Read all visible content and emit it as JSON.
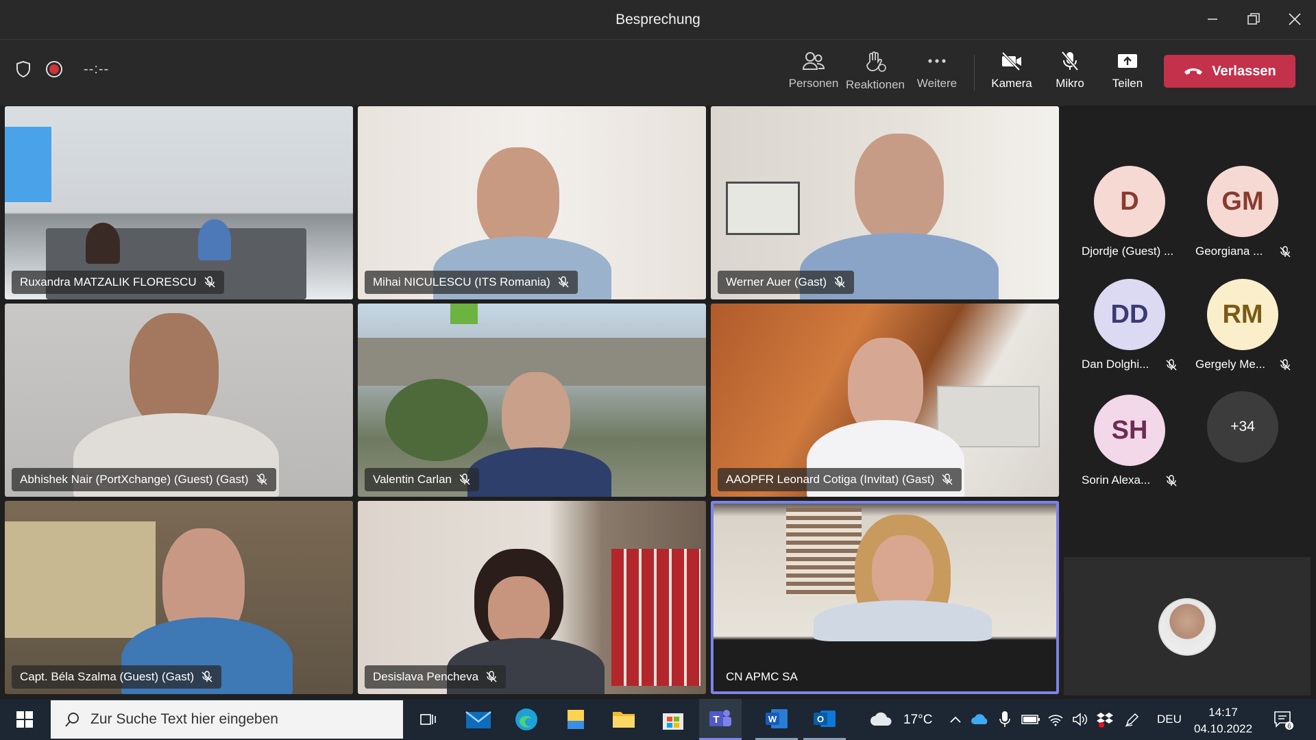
{
  "window": {
    "title": "Besprechung"
  },
  "toolbar": {
    "timer": "--:--",
    "people_label": "Personen",
    "reactions_label": "Reaktionen",
    "more_label": "Weitere",
    "camera_label": "Kamera",
    "mic_label": "Mikro",
    "share_label": "Teilen",
    "leave_label": "Verlassen",
    "leave_color": "#c4314b"
  },
  "tiles": [
    {
      "name": "Ruxandra MATZALIK FLORESCU",
      "muted": true
    },
    {
      "name": "Mihai NICULESCU (ITS Romania)",
      "muted": true
    },
    {
      "name": "Werner Auer (Gast)",
      "muted": true
    },
    {
      "name": "Abhishek Nair (PortXchange) (Guest) (Gast)",
      "muted": true
    },
    {
      "name": "Valentin Carlan",
      "muted": true
    },
    {
      "name": "AAOPFR Leonard Cotiga (Invitat) (Gast)",
      "muted": true
    },
    {
      "name": "Capt. Béla Szalma (Guest) (Gast)",
      "muted": true
    },
    {
      "name": "Desislava Pencheva",
      "muted": true
    },
    {
      "name": "CN APMC SA",
      "muted": false,
      "active": true
    }
  ],
  "participants": [
    {
      "initials": "D",
      "name": "Djordje (Guest) ...",
      "bg": "#f7d9d4",
      "fg": "#8a3b2e",
      "muted": false
    },
    {
      "initials": "GM",
      "name": "Georgiana ...",
      "bg": "#f7d9d4",
      "fg": "#8a3b2e",
      "muted": true
    },
    {
      "initials": "DD",
      "name": "Dan Dolghi...",
      "bg": "#dcdaf2",
      "fg": "#3b3a73",
      "muted": true
    },
    {
      "initials": "RM",
      "name": "Gergely Me...",
      "bg": "#fbeecb",
      "fg": "#7a5a14",
      "muted": true
    },
    {
      "initials": "SH",
      "name": "Sorin Alexa...",
      "bg": "#f2d8e8",
      "fg": "#6d2b55",
      "muted": true
    }
  ],
  "more_count": "+34",
  "taskbar": {
    "search_placeholder": "Zur Suche Text hier eingeben",
    "weather": "17°C",
    "language": "DEU",
    "time": "14:17",
    "date": "04.10.2022",
    "notifications": "6"
  }
}
